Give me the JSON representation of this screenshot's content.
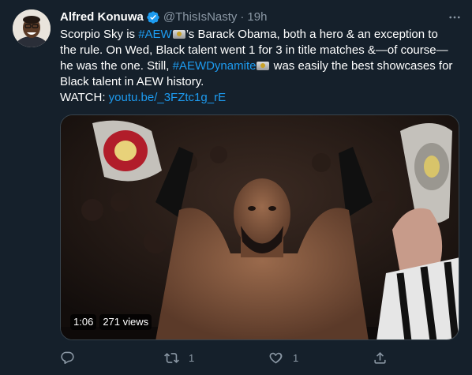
{
  "tweet": {
    "author_name": "Alfred Konuwa",
    "handle": "@ThisIsNasty",
    "separator": "·",
    "time": "19h",
    "lines": [
      {
        "a": "Scorpio Sky is ",
        "hashtag": "#AEW",
        "b": "’s Barack Obama, both a hero & an exception to"
      },
      {
        "a": "the rule. On Wed, Black talent went 1 for 3 in title matches &—of course—"
      },
      {
        "a": "he was the one. Still, ",
        "hashtag": "#AEWDynamite",
        "b": " was easily the best showcases for"
      },
      {
        "a": "Black talent in AEW history."
      },
      {
        "a": "WATCH: ",
        "link": "youtu.be/_3FZtc1g_rE"
      }
    ]
  },
  "media": {
    "duration": "1:06",
    "views": "271 views"
  },
  "actions": {
    "reply": {
      "icon": "reply-icon",
      "count": ""
    },
    "retweet": {
      "icon": "retweet-icon",
      "count": "1"
    },
    "like": {
      "icon": "heart-icon",
      "count": "1"
    },
    "share": {
      "icon": "share-icon",
      "count": ""
    }
  },
  "colors": {
    "background": "#15202b",
    "text": "#ffffff",
    "secondary": "#8b98a5",
    "link": "#1d9bf0",
    "verified": "#1d9bf0"
  }
}
